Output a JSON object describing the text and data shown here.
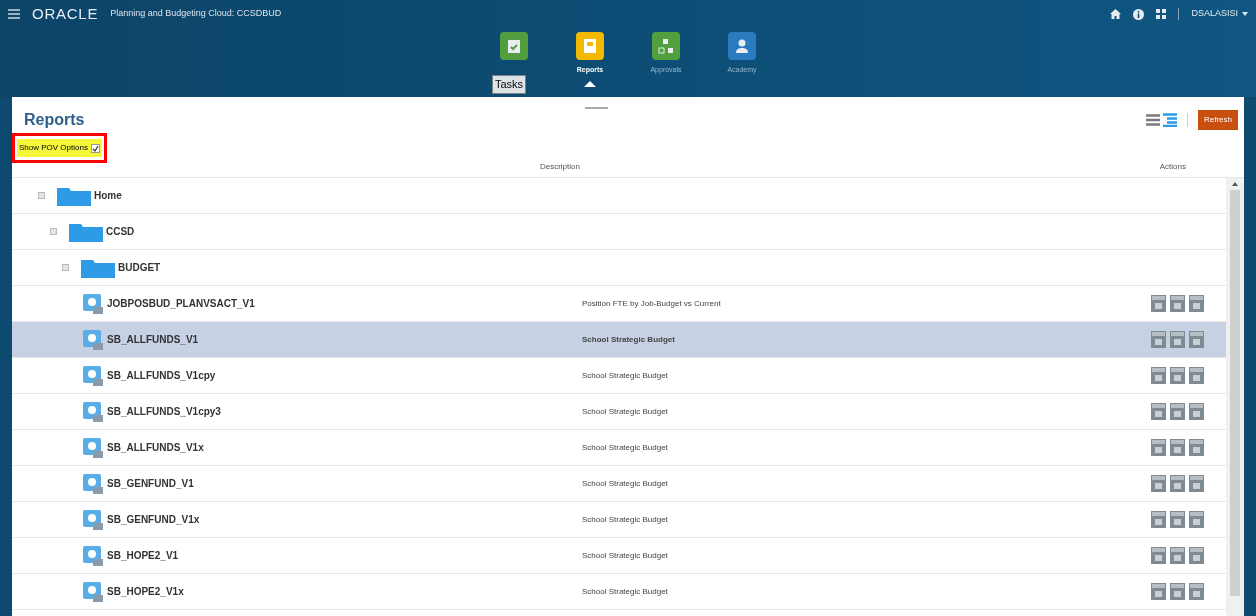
{
  "header": {
    "brand": "ORACLE",
    "app_title": "Planning and Budgeting Cloud: CCSDBUD",
    "user": "DSALASISI"
  },
  "nav": [
    {
      "kind": "tasks",
      "selected": false,
      "tooltip": "Tasks"
    },
    {
      "kind": "reports",
      "label": "Reports",
      "selected": true
    },
    {
      "kind": "approvals",
      "label": "Approvals",
      "selected": false
    },
    {
      "kind": "academy",
      "label": "Academy",
      "selected": false
    }
  ],
  "panel": {
    "title": "Reports",
    "refresh": "Refresh",
    "pov": {
      "label": "Show POV Options",
      "checked": true
    }
  },
  "table": {
    "columns": [
      "Description",
      "Actions"
    ],
    "tree": [
      {
        "name": "Home",
        "expanded": true,
        "children": [
          {
            "name": "CCSD",
            "expanded": true,
            "children": [
              {
                "name": "BUDGET",
                "expanded": true,
                "children": [
                  {
                    "name": "JOBPOSBUD_PLANVSACT_V1",
                    "description": "Position FTE by Job-Budget vs Current",
                    "selected": false
                  },
                  {
                    "name": "SB_ALLFUNDS_V1",
                    "description": "School Strategic Budget",
                    "selected": true
                  },
                  {
                    "name": "SB_ALLFUNDS_V1cpy",
                    "description": "School Strategic Budget",
                    "selected": false
                  },
                  {
                    "name": "SB_ALLFUNDS_V1cpy3",
                    "description": "School Strategic Budget",
                    "selected": false
                  },
                  {
                    "name": "SB_ALLFUNDS_V1x",
                    "description": "School Strategic Budget",
                    "selected": false
                  },
                  {
                    "name": "SB_GENFUND_V1",
                    "description": "School Strategic Budget",
                    "selected": false
                  },
                  {
                    "name": "SB_GENFUND_V1x",
                    "description": "School Strategic Budget",
                    "selected": false
                  },
                  {
                    "name": "SB_HOPE2_V1",
                    "description": "School Strategic Budget",
                    "selected": false
                  },
                  {
                    "name": "SB_HOPE2_V1x",
                    "description": "School Strategic Budget",
                    "selected": false
                  }
                ]
              }
            ]
          }
        ]
      }
    ]
  }
}
